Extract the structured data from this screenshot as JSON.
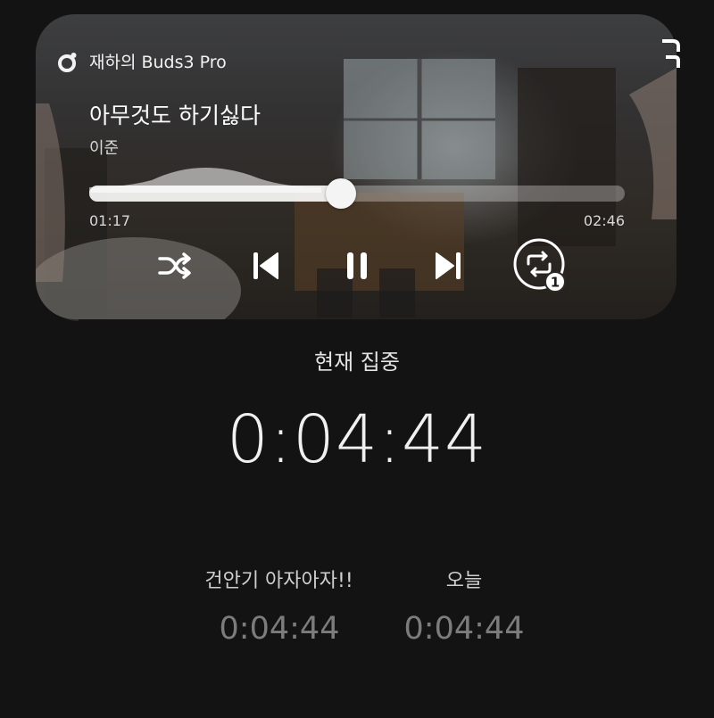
{
  "player": {
    "device_icon": "earbuds-icon",
    "device_name": "재하의 Buds3 Pro",
    "title": "아무것도 하기싫다",
    "artist": "이준",
    "elapsed": "01:17",
    "duration": "02:46",
    "progress": 0.47,
    "controls": {
      "shuffle_icon": "shuffle-icon",
      "previous_icon": "skip-previous-icon",
      "pause_icon": "pause-icon",
      "next_icon": "skip-next-icon",
      "repeat_icon": "repeat-one-icon",
      "repeat_badge": "1"
    }
  },
  "focus": {
    "current_label": "현재 집중",
    "current_time": "0:04:44",
    "items": [
      {
        "label": "건안기 아자아자!!",
        "time": "0:04:44"
      },
      {
        "label": "오늘",
        "time": "0:04:44"
      }
    ]
  }
}
